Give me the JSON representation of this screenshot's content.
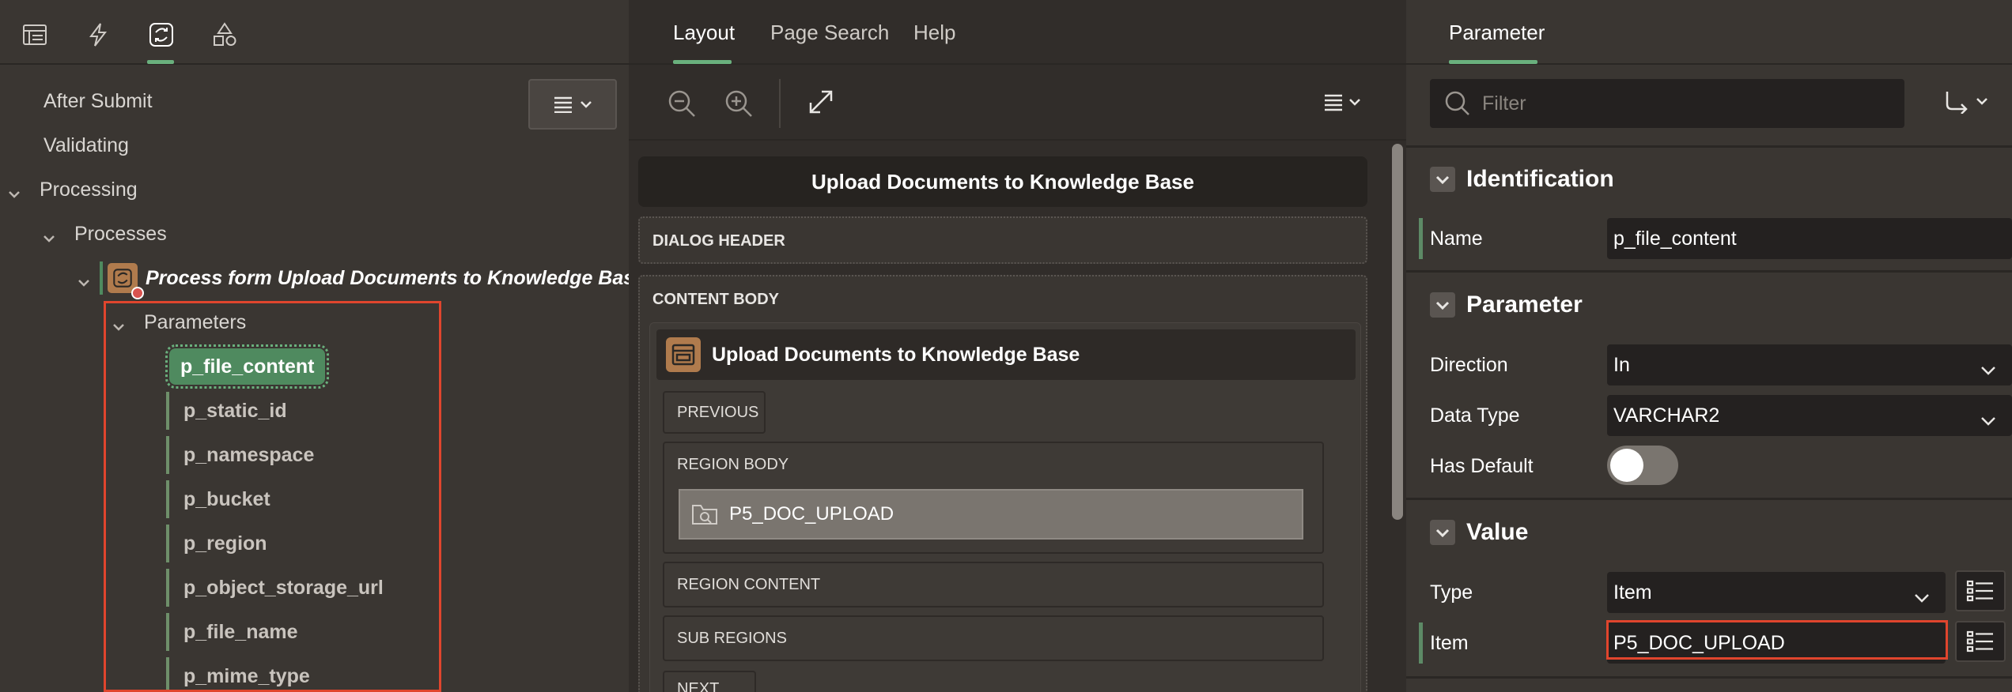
{
  "left": {
    "toolbar_icons": [
      "rendering-icon",
      "dynamic-actions-icon",
      "processing-icon",
      "shared-components-icon"
    ],
    "tree": [
      {
        "label": "After Submit"
      },
      {
        "label": "Validating"
      },
      {
        "label": "Processing"
      },
      {
        "label": "Processes"
      },
      {
        "label": "Process form Upload Documents to Knowledge Base"
      },
      {
        "label": "Parameters"
      }
    ],
    "parameters": [
      "p_file_content",
      "p_static_id",
      "p_namespace",
      "p_bucket",
      "p_region",
      "p_object_storage_url",
      "p_file_name",
      "p_mime_type"
    ]
  },
  "middle": {
    "tabs": [
      "Layout",
      "Page Search",
      "Help"
    ],
    "dialog_title": "Upload Documents to Knowledge Base",
    "dialog_header": "DIALOG HEADER",
    "content_body": "CONTENT BODY",
    "region_title": "Upload Documents to Knowledge Base",
    "previous": "PREVIOUS",
    "region_body": "REGION BODY",
    "item_name": "P5_DOC_UPLOAD",
    "region_content": "REGION CONTENT",
    "sub_regions": "SUB REGIONS",
    "next": "NEXT"
  },
  "right": {
    "tab": "Parameter",
    "filter_placeholder": "Filter",
    "sections": {
      "identification": "Identification",
      "parameter": "Parameter",
      "value": "Value"
    },
    "props": {
      "name_label": "Name",
      "name_value": "p_file_content",
      "direction_label": "Direction",
      "direction_value": "In",
      "datatype_label": "Data Type",
      "datatype_value": "VARCHAR2",
      "hasdefault_label": "Has Default",
      "type_label": "Type",
      "type_value": "Item",
      "item_label": "Item",
      "item_value": "P5_DOC_UPLOAD"
    }
  },
  "colors": {
    "accent_green": "#6ab07d",
    "selected_bg": "#4f8a5f",
    "highlight_red": "#e0452d"
  }
}
